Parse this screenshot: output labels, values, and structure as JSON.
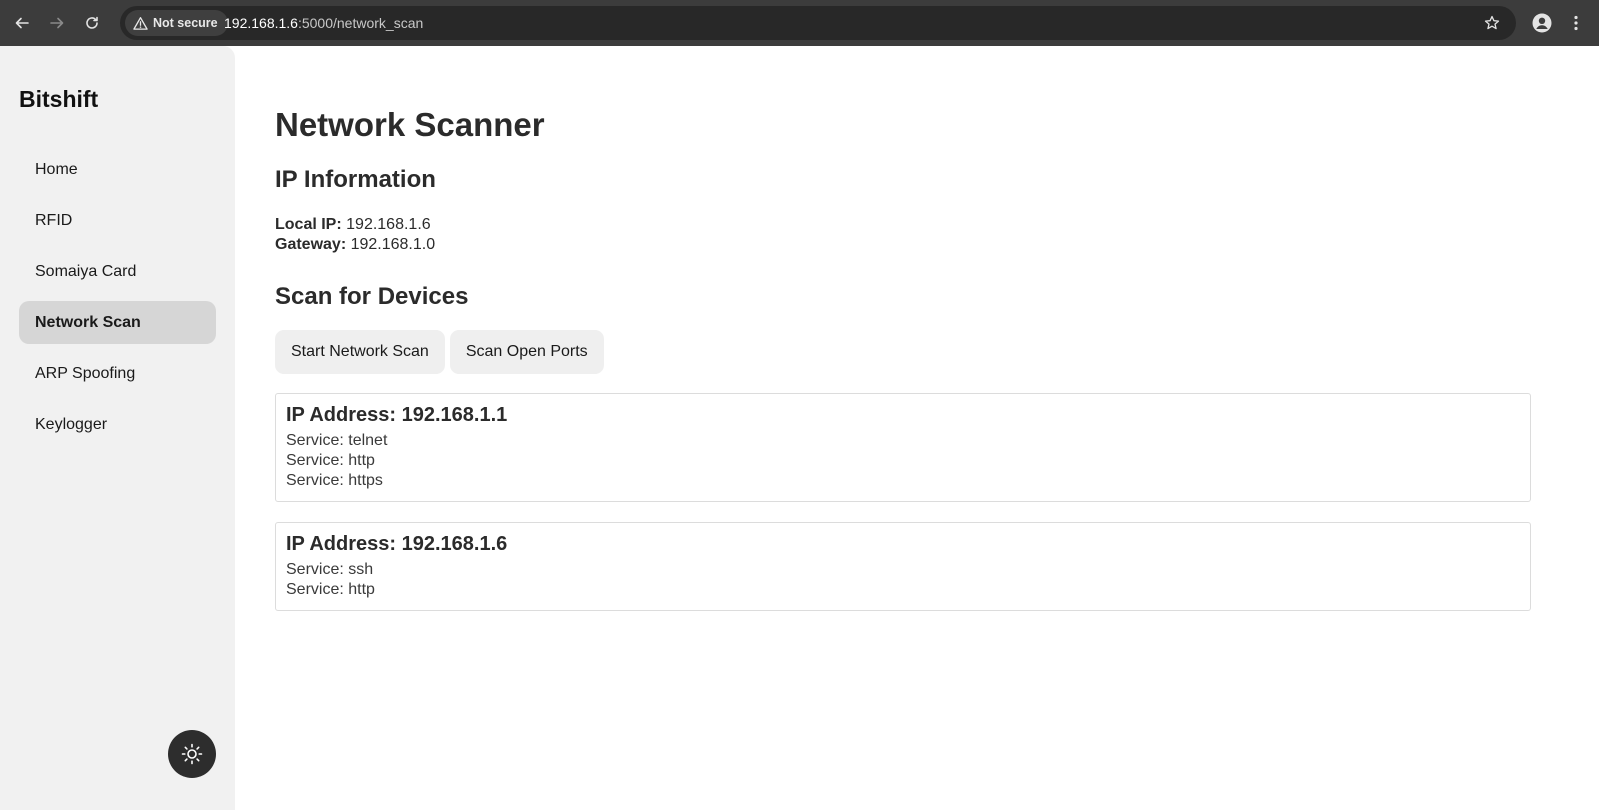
{
  "browser": {
    "security_label": "Not secure",
    "url_host": "192.168.1.6",
    "url_rest": ":5000/network_scan"
  },
  "sidebar": {
    "brand": "Bitshift",
    "items": [
      {
        "label": "Home"
      },
      {
        "label": "RFID"
      },
      {
        "label": "Somaiya Card"
      },
      {
        "label": "Network Scan",
        "active": true
      },
      {
        "label": "ARP Spoofing"
      },
      {
        "label": "Keylogger"
      }
    ],
    "theme_toggle_icon": "sun-icon"
  },
  "main": {
    "title": "Network Scanner",
    "ip_info": {
      "heading": "IP Information",
      "local_ip_label": "Local IP:",
      "local_ip_value": "192.168.1.6",
      "gateway_label": "Gateway:",
      "gateway_value": "192.168.1.0"
    },
    "scan": {
      "heading": "Scan for Devices",
      "start_button": "Start Network Scan",
      "ports_button": "Scan Open Ports"
    },
    "devices": [
      {
        "ip_label": "IP Address: 192.168.1.1",
        "services": [
          "Service: telnet",
          "Service: http",
          "Service: https"
        ]
      },
      {
        "ip_label": "IP Address: 192.168.1.6",
        "services": [
          "Service: ssh",
          "Service: http"
        ]
      }
    ]
  },
  "colors": {
    "chrome_bg": "#3c3c3c",
    "sidebar_bg": "#f1f1f1",
    "active_item_bg": "#d6d6d6",
    "button_bg": "#efefef",
    "text": "#2b2b2b"
  }
}
